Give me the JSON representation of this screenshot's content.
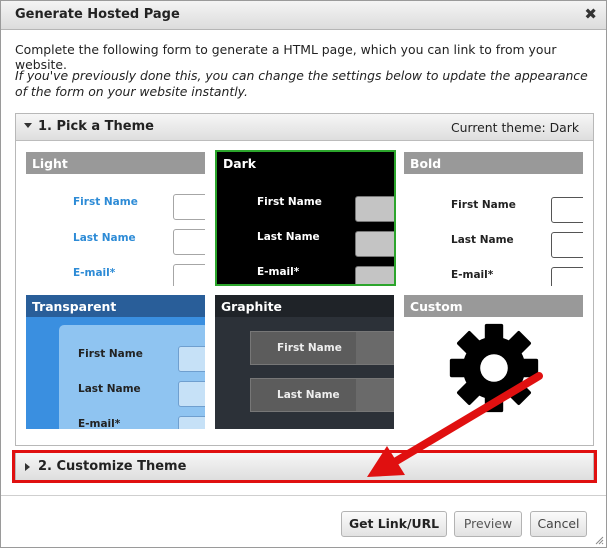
{
  "dialog": {
    "title": "Generate Hosted Page",
    "close_symbol": "✖"
  },
  "intro_text": "Complete the following form to generate a HTML page, which you can link to from your website.",
  "note_text": "If you've previously done this, you can change the settings below to update the appearance of the form on your website instantly.",
  "pick_theme": {
    "title": "1. Pick a Theme",
    "current_theme": "Current theme: Dark"
  },
  "themes": {
    "light": {
      "label": "Light",
      "fields": [
        "First Name",
        "Last Name",
        "E-mail*"
      ]
    },
    "dark": {
      "label": "Dark",
      "fields": [
        "First Name",
        "Last Name",
        "E-mail*"
      ],
      "selected": true
    },
    "bold": {
      "label": "Bold",
      "fields": [
        "First Name",
        "Last Name",
        "E-mail*"
      ]
    },
    "transparent": {
      "label": "Transparent",
      "fields": [
        "First Name",
        "Last Name",
        "E-mail*"
      ]
    },
    "graphite": {
      "label": "Graphite",
      "fields": [
        "First Name",
        "Last Name"
      ]
    },
    "custom": {
      "label": "Custom",
      "icon": "gear-icon"
    }
  },
  "customize_theme": {
    "title": "2. Customize Theme"
  },
  "buttons": {
    "get_link": "Get Link/URL",
    "preview": "Preview",
    "cancel": "Cancel"
  },
  "colors": {
    "highlight": "#e01010",
    "selected_border": "#2ca52c",
    "light_field_blue": "#2d8bd6"
  }
}
